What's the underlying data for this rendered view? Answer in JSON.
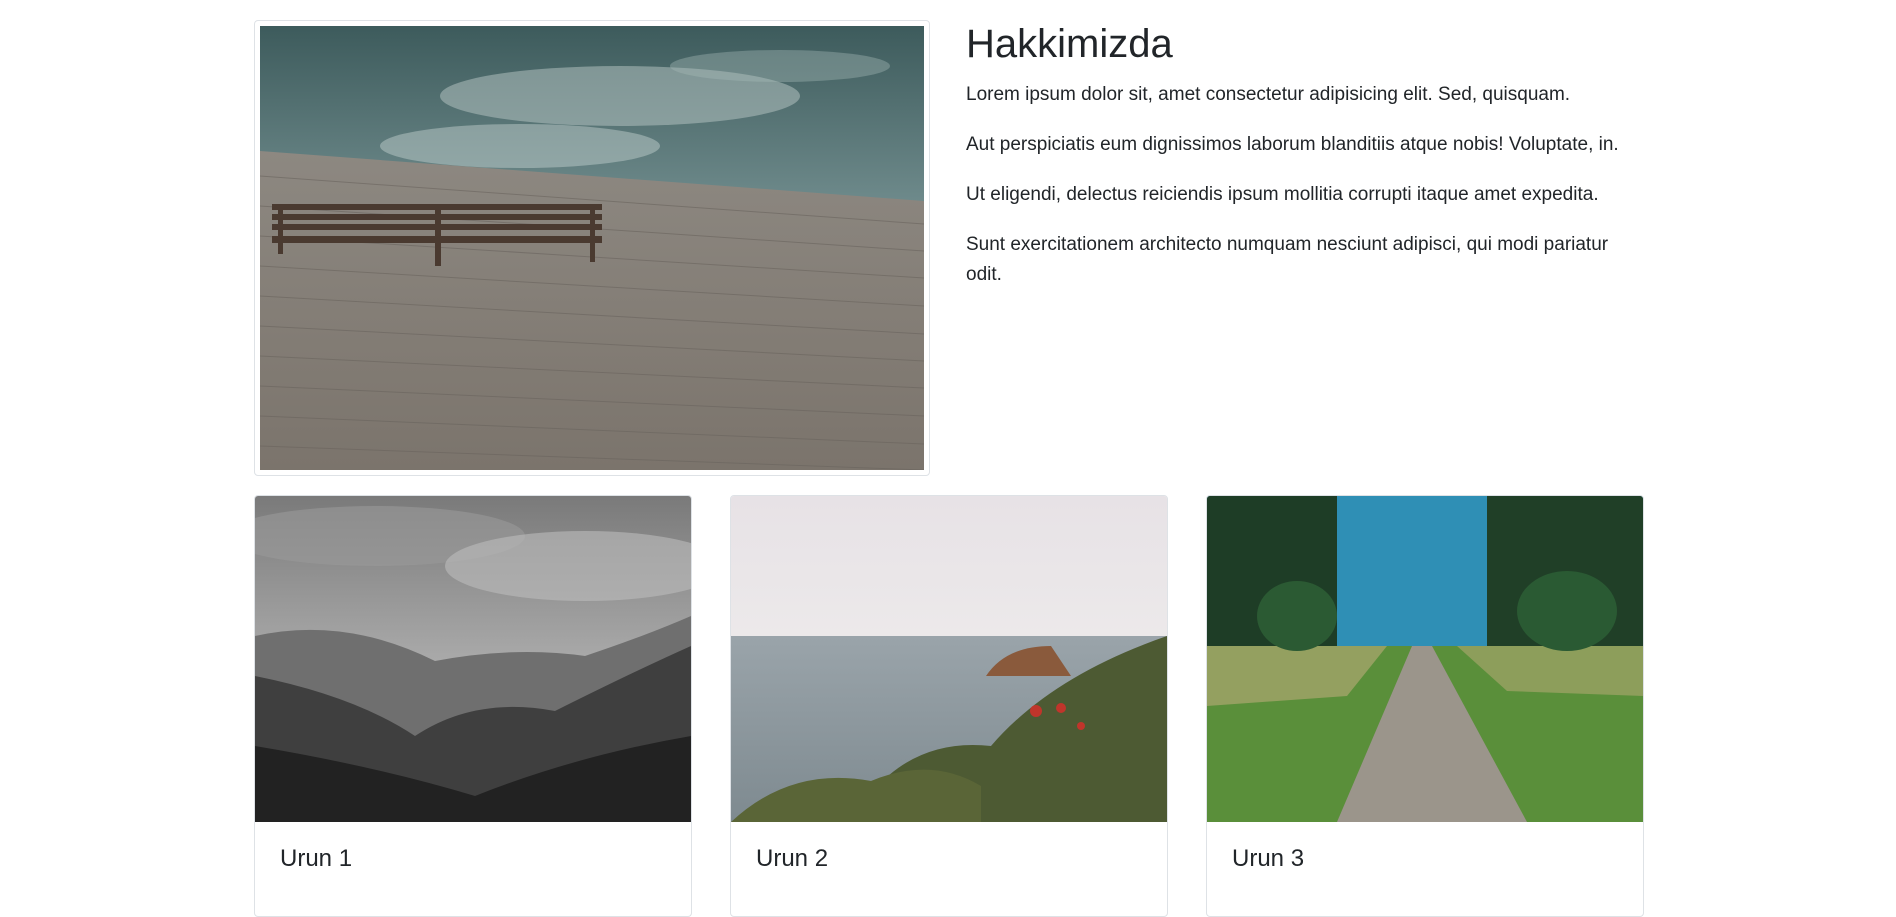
{
  "about": {
    "title": "Hakkimizda",
    "image_alt": "wooden pier with bench by the water",
    "paragraphs": [
      "Lorem ipsum dolor sit, amet consectetur adipisicing elit. Sed, quisquam.",
      "Aut perspiciatis eum dignissimos laborum blanditiis atque nobis! Voluptate, in.",
      "Ut eligendi, delectus reiciendis ipsum mollitia corrupti itaque amet expedita.",
      "Sunt exercitationem architecto numquam nesciunt adipisci, qui modi pariatur odit."
    ]
  },
  "products": [
    {
      "title": "Urun 1",
      "image": "black-and-white mountain valley with forest"
    },
    {
      "title": "Urun 2",
      "image": "sea coast with red flowers and rocky island"
    },
    {
      "title": "Urun 3",
      "image": "grass field with gravel path and pine trees"
    }
  ]
}
